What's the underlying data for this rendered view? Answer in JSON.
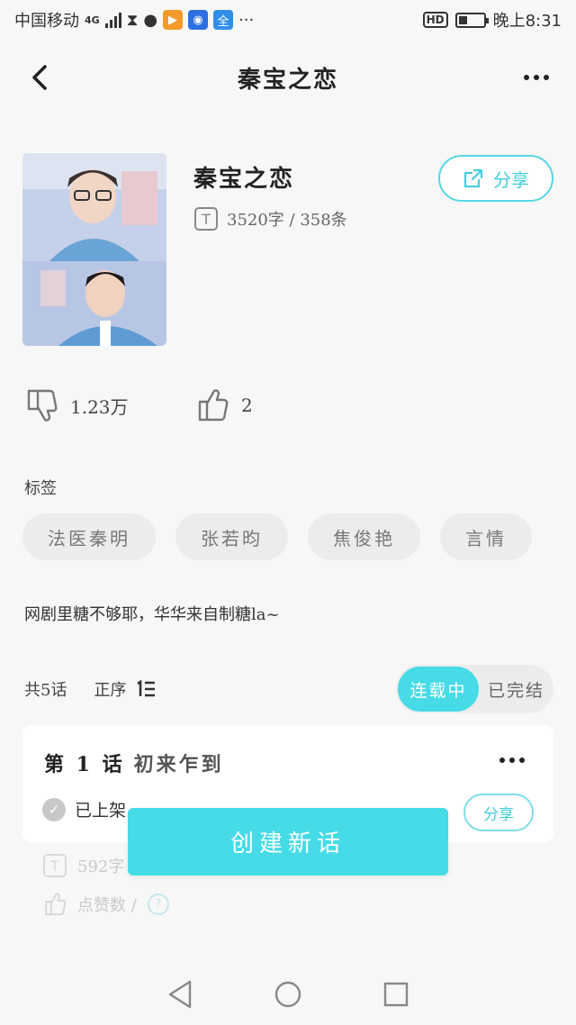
{
  "status_bar": {
    "carrier": "中国移动",
    "network": "4G",
    "time": "晚上8:31",
    "hd_label": "HD",
    "app_badge": "全",
    "more": "···",
    "battery_level": 0.35
  },
  "nav": {
    "title": "秦宝之恋"
  },
  "book": {
    "title": "秦宝之恋",
    "stats": "3520字 / 358条",
    "share_label": "分享"
  },
  "likes": {
    "dislike_count": "1.23万",
    "like_count": "2"
  },
  "tags": {
    "label": "标签",
    "items": [
      "法医秦明",
      "张若昀",
      "焦俊艳",
      "言情"
    ]
  },
  "description": "网剧里糖不够耶，华华来自制糖la~",
  "episodes": {
    "total": "共5话",
    "order": "正序",
    "filter_active": "连载中",
    "filter_inactive": "已完结",
    "first": {
      "number": "第 1 话",
      "name": "初来乍到",
      "status": "已上架",
      "share_label": "分享",
      "words": "592字",
      "likes": "点赞数 /"
    }
  },
  "create_button": "创建新话",
  "colors": {
    "accent": "#45dbe7",
    "background": "#f7f7f7"
  }
}
